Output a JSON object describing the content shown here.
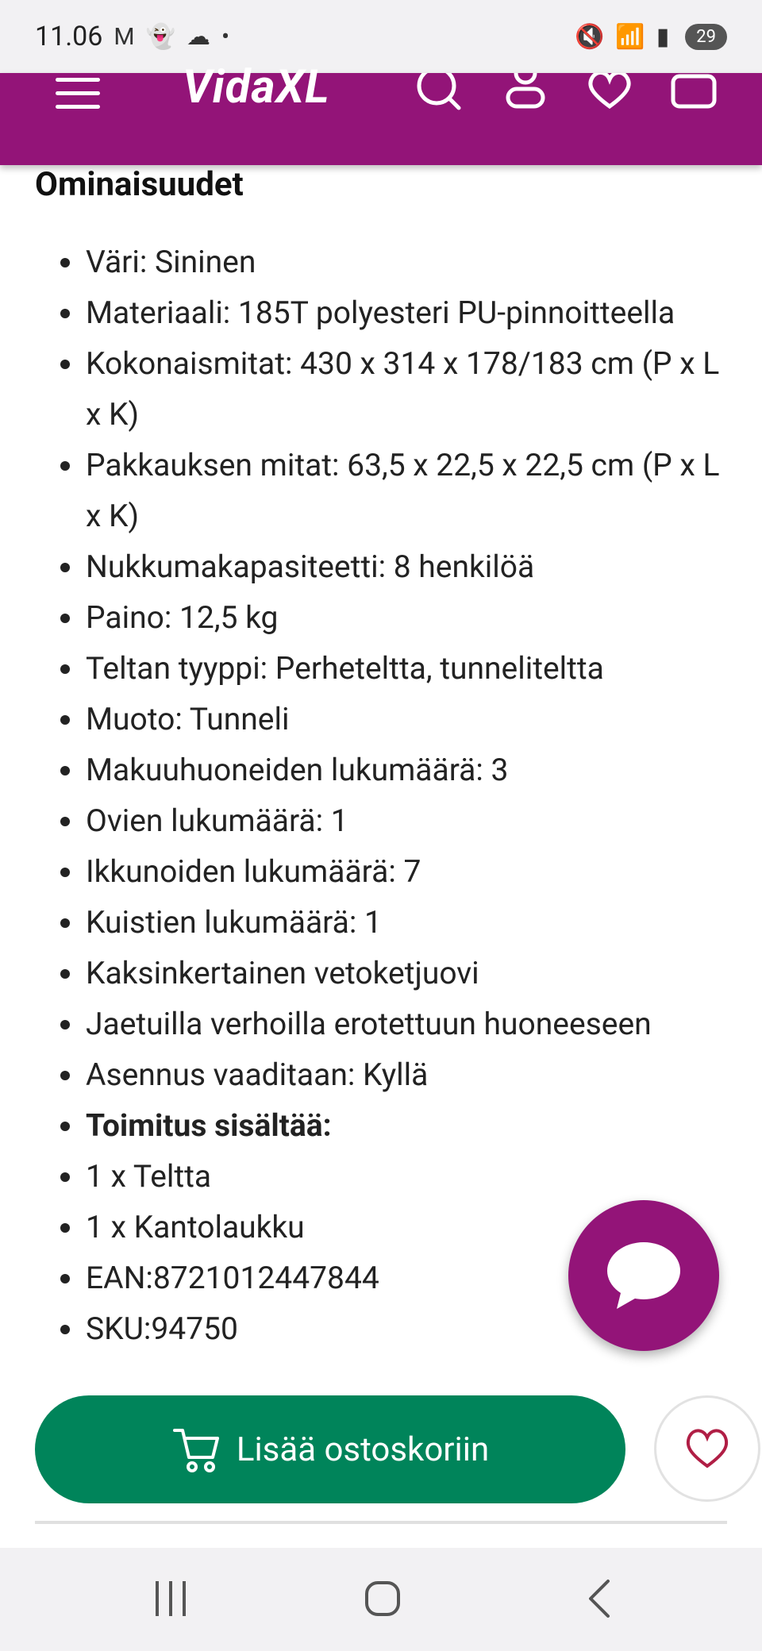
{
  "status": {
    "time": "11.06",
    "battery": "29"
  },
  "header": {
    "logo": "VidaXL"
  },
  "section": {
    "title": "Ominaisuudet"
  },
  "features": [
    {
      "text": "Väri: Sininen"
    },
    {
      "text": "Materiaali: 185T polyesteri PU-pinnoitteella"
    },
    {
      "text": "Kokonaismitat: 430 x 314 x 178/183 cm (P x L x K)"
    },
    {
      "text": "Pakkauksen mitat: 63,5 x 22,5 x 22,5 cm (P x L x K)"
    },
    {
      "text": "Nukkumakapasiteetti: 8 henkilöä"
    },
    {
      "text": "Paino: 12,5 kg"
    },
    {
      "text": "Teltan tyyppi: Perheteltta, tunneliteltta"
    },
    {
      "text": "Muoto: Tunneli"
    },
    {
      "text": "Makuuhuoneiden lukumäärä: 3"
    },
    {
      "text": "Ovien lukumäärä: 1"
    },
    {
      "text": "Ikkunoiden lukumäärä: 7"
    },
    {
      "text": "Kuistien lukumäärä: 1"
    },
    {
      "text": "Kaksinkertainen vetoketjuovi"
    },
    {
      "text": "Jaetuilla verhoilla erotettuun huoneeseen"
    },
    {
      "text": "Asennus vaaditaan: Kyllä"
    },
    {
      "text": "Toimitus sisältää:",
      "bold": true
    },
    {
      "text": "1 x Teltta"
    },
    {
      "text": "1 x Kantolaukku"
    },
    {
      "text": "EAN:8721012447844"
    },
    {
      "text": "SKU:94750"
    }
  ],
  "actions": {
    "add_to_cart": "Lisää ostoskoriin"
  },
  "colors": {
    "brand": "#931478",
    "cart_button": "#00845a",
    "heart": "#b01e45"
  }
}
